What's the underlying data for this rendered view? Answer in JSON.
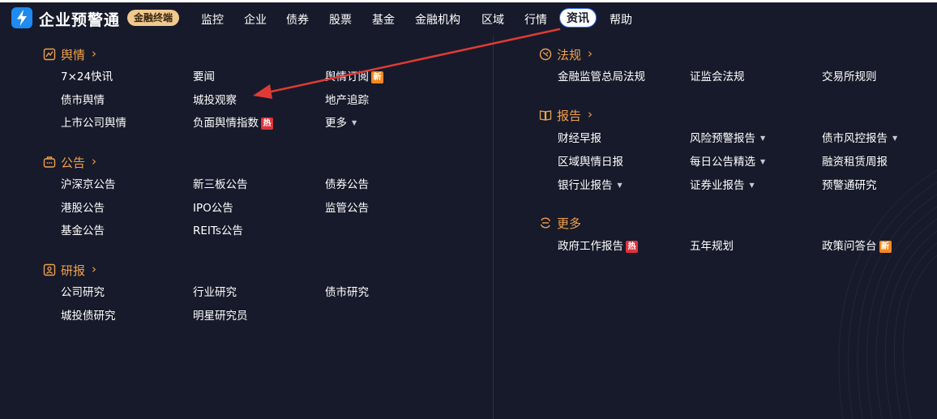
{
  "brand": {
    "name": "企业预警通",
    "edition": "金融终端"
  },
  "nav": [
    {
      "label": "监控"
    },
    {
      "label": "企业"
    },
    {
      "label": "债券"
    },
    {
      "label": "股票"
    },
    {
      "label": "基金"
    },
    {
      "label": "金融机构"
    },
    {
      "label": "区域"
    },
    {
      "label": "行情"
    },
    {
      "label": "资讯",
      "active": true
    },
    {
      "label": "帮助"
    }
  ],
  "chevron": "›",
  "caret": "▼",
  "badges": {
    "new": "新",
    "hot": "热"
  },
  "left": {
    "yuqing": {
      "title": "舆情",
      "items": [
        {
          "label": "7×24快讯"
        },
        {
          "label": "要闻"
        },
        {
          "label": "舆情订阅",
          "badge": "new"
        },
        {
          "label": "债市舆情"
        },
        {
          "label": "城投观察"
        },
        {
          "label": "地产追踪"
        },
        {
          "label": "上市公司舆情"
        },
        {
          "label": "负面舆情指数",
          "badge": "hot"
        },
        {
          "label": "更多",
          "dropdown": true
        }
      ]
    },
    "gonggao": {
      "title": "公告",
      "items": [
        {
          "label": "沪深京公告"
        },
        {
          "label": "新三板公告"
        },
        {
          "label": "债券公告"
        },
        {
          "label": "港股公告"
        },
        {
          "label": "IPO公告"
        },
        {
          "label": "监管公告"
        },
        {
          "label": "基金公告"
        },
        {
          "label": "REITs公告"
        }
      ]
    },
    "yanbao": {
      "title": "研报",
      "items": [
        {
          "label": "公司研究"
        },
        {
          "label": "行业研究"
        },
        {
          "label": "债市研究"
        },
        {
          "label": "城投债研究"
        },
        {
          "label": "明星研究员"
        }
      ]
    }
  },
  "right": {
    "fagui": {
      "title": "法规",
      "items": [
        {
          "label": "金融监管总局法规"
        },
        {
          "label": "证监会法规"
        },
        {
          "label": "交易所规则"
        }
      ]
    },
    "baogao": {
      "title": "报告",
      "items": [
        {
          "label": "财经早报"
        },
        {
          "label": "风险预警报告",
          "dropdown": true
        },
        {
          "label": "债市风控报告",
          "dropdown": true
        },
        {
          "label": "区域舆情日报"
        },
        {
          "label": "每日公告精选",
          "dropdown": true
        },
        {
          "label": "融资租赁周报"
        },
        {
          "label": "银行业报告",
          "dropdown": true
        },
        {
          "label": "证券业报告",
          "dropdown": true
        },
        {
          "label": "预警通研究"
        }
      ]
    },
    "gengduo": {
      "title": "更多",
      "items": [
        {
          "label": "政府工作报告",
          "badge": "hot"
        },
        {
          "label": "五年规划"
        },
        {
          "label": "政策问答台",
          "badge": "new"
        }
      ]
    }
  },
  "colors": {
    "background": "#171a2a",
    "accent_orange": "#f0a14a",
    "badge_new": "#f5891f",
    "badge_hot": "#e0323c",
    "active_border": "#3b70f5",
    "annotation_arrow": "#e03a35"
  },
  "icons": {
    "logo": "lightning-bolt-icon",
    "yuqing": "chart-line-icon",
    "gonggao": "briefcase-icon",
    "yanbao": "report-user-icon",
    "fagui": "law-badge-icon",
    "baogao": "open-book-icon",
    "gengduo": "refresh-cycle-icon"
  }
}
